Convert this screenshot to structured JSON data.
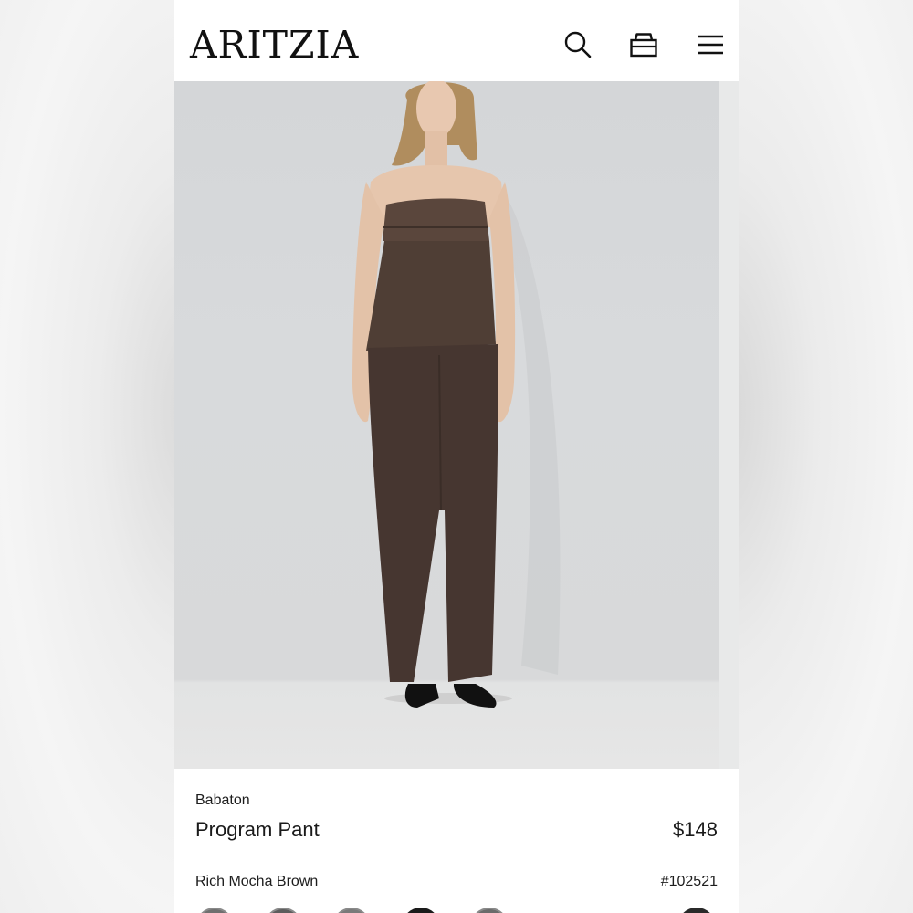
{
  "header": {
    "logo": "ARITZIA",
    "icons": [
      "search-icon",
      "bag-icon",
      "menu-icon"
    ]
  },
  "product": {
    "brand": "Babaton",
    "name": "Program Pant",
    "price": "$148",
    "color_name": "Rich Mocha Brown",
    "sku": "#102521"
  },
  "colors": {
    "product_brown": "#4a3a32",
    "text": "#1a1a1a",
    "background": "#ffffff"
  }
}
